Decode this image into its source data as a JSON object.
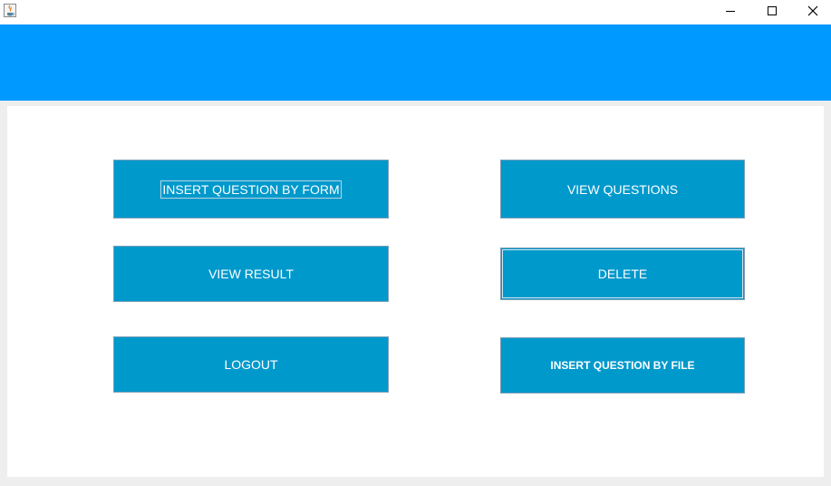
{
  "window": {
    "icon": "java-cup-icon",
    "controls": [
      "minimize-icon",
      "maximize-icon",
      "close-icon"
    ]
  },
  "colors": {
    "header": "#0099ff",
    "button": "#0099cc",
    "panel": "#ffffff",
    "frame": "#eeeeee"
  },
  "menu": {
    "insert_by_form": "INSERT QUESTION BY FORM",
    "view_questions": "VIEW QUESTIONS",
    "view_result": "VIEW RESULT",
    "delete": "DELETE",
    "logout": "LOGOUT",
    "insert_by_file": "INSERT QUESTION BY FILE"
  }
}
